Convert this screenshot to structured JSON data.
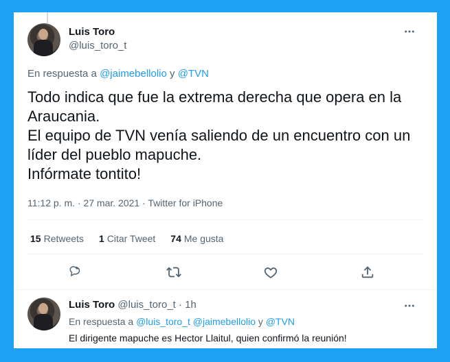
{
  "main_tweet": {
    "author_name": "Luis Toro",
    "author_handle": "@luis_toro_t",
    "reply_prefix": "En respuesta a",
    "reply_mention_1": "@jaimebellolio",
    "reply_conjunction": "y",
    "reply_mention_2": "@TVN",
    "text": "Todo indica que fue la extrema derecha que opera en la Araucania.\nEl equipo de TVN venía saliendo de un encuentro con un líder del pueblo mapuche.\nInfórmate tontito!",
    "timestamp": "11:12 p. m. · 27 mar. 2021 · Twitter for iPhone",
    "stats": {
      "retweets_count": "15",
      "retweets_label": "Retweets",
      "quotes_count": "1",
      "quotes_label": "Citar Tweet",
      "likes_count": "74",
      "likes_label": "Me gusta"
    },
    "icons": {
      "more": "more-horizontal-icon",
      "reply": "reply-icon",
      "retweet": "retweet-icon",
      "like": "heart-icon",
      "share": "share-icon"
    }
  },
  "reply_tweet": {
    "author_name": "Luis Toro",
    "author_handle": "@luis_toro_t",
    "separator": "·",
    "time": "1h",
    "reply_prefix": "En respuesta a",
    "reply_mention_1": "@luis_toro_t",
    "reply_mention_2": "@jaimebellolio",
    "reply_conjunction": "y",
    "reply_mention_3": "@TVN",
    "text": "El dirigente mapuche es Hector Llaitul, quien confirmó la reunión!"
  },
  "colors": {
    "frame": "#1da1f2",
    "link": "#1d9bf0",
    "muted": "#536471",
    "text": "#0f1419"
  }
}
